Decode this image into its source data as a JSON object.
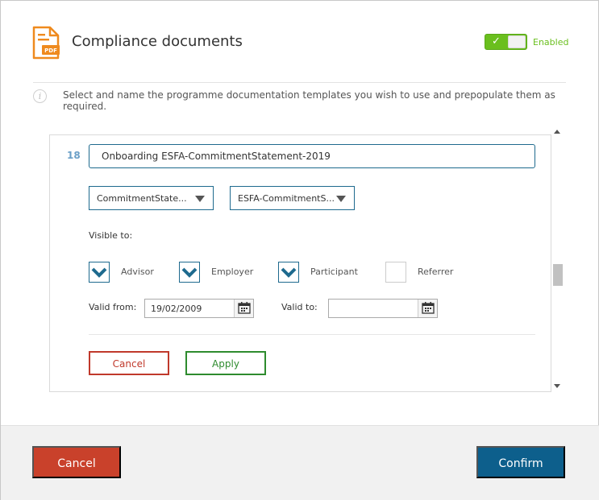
{
  "header": {
    "title": "Compliance documents",
    "toggle": {
      "label": "Enabled",
      "state": "on",
      "color": "#6abf1e"
    },
    "icon": "pdf-document-icon",
    "icon_text": "PDF"
  },
  "info": {
    "icon": "info-icon",
    "text": "Select and name the programme documentation templates you wish to use and prepopulate them as required."
  },
  "document": {
    "number": "18",
    "name": "Onboarding ESFA-CommitmentStatement-2019",
    "select_template": "CommitmentState...",
    "select_document": "ESFA-CommitmentS...",
    "visible_to_label": "Visible to:",
    "visibility": [
      {
        "label": "Advisor",
        "checked": true
      },
      {
        "label": "Employer",
        "checked": true
      },
      {
        "label": "Participant",
        "checked": true
      },
      {
        "label": "Referrer",
        "checked": false
      }
    ],
    "valid_from_label": "Valid from:",
    "valid_from": "19/02/2009",
    "valid_to_label": "Valid to:",
    "valid_to": "",
    "cancel_label": "Cancel",
    "apply_label": "Apply"
  },
  "footer": {
    "cancel_label": "Cancel",
    "confirm_label": "Confirm"
  },
  "colors": {
    "primary": "#0d5f8c",
    "danger": "#c9412b",
    "success": "#2e8b2e",
    "pdf_icon": "#ef8a1e"
  }
}
